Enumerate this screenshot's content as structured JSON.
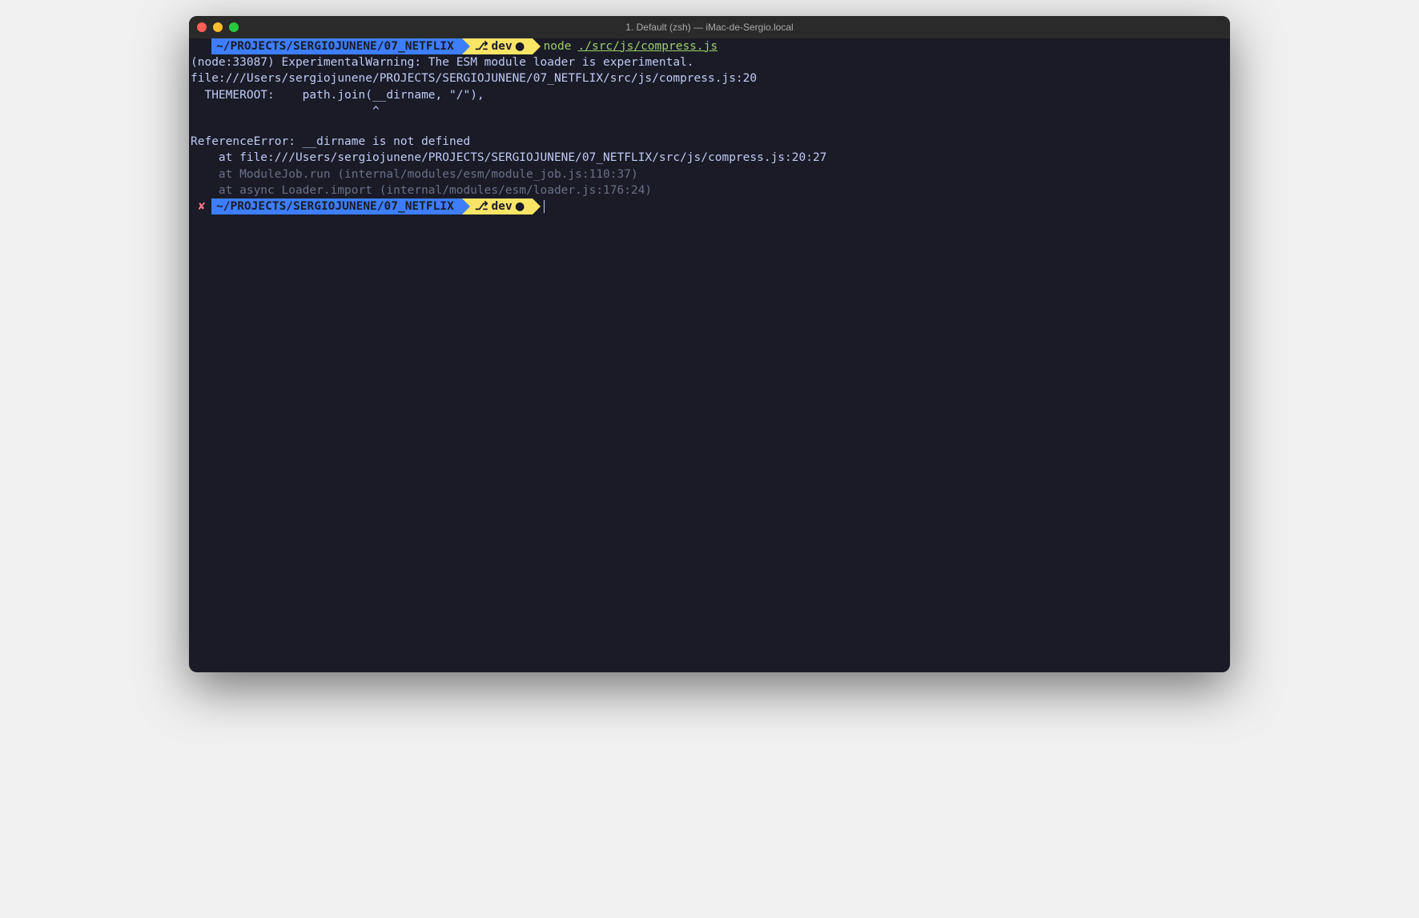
{
  "titlebar": {
    "title": "1. Default (zsh) — iMac-de-Sergio.local"
  },
  "prompt1": {
    "path": "~/PROJECTS/SERGIOJUNENE/07_NETFLIX",
    "branch": "dev",
    "dirty": "●",
    "cmd_node": "node",
    "cmd_arg": "./src/js/compress.js"
  },
  "output": {
    "l1": "(node:33087) ExperimentalWarning: The ESM module loader is experimental.",
    "l2": "file:///Users/sergiojunene/PROJECTS/SERGIOJUNENE/07_NETFLIX/src/js/compress.js:20",
    "l3": "  THEMEROOT:    path.join(__dirname, \"/\"),",
    "l4": "                          ^",
    "l5": "",
    "l6": "ReferenceError: __dirname is not defined",
    "l7": "    at file:///Users/sergiojunene/PROJECTS/SERGIOJUNENE/07_NETFLIX/src/js/compress.js:20:27",
    "l8": "    at ModuleJob.run (internal/modules/esm/module_job.js:110:37)",
    "l9": "    at async Loader.import (internal/modules/esm/loader.js:176:24)"
  },
  "prompt2": {
    "status": "✘",
    "path": "~/PROJECTS/SERGIOJUNENE/07_NETFLIX",
    "branch": "dev",
    "dirty": "●"
  },
  "icons": {
    "branch": "⎇"
  }
}
